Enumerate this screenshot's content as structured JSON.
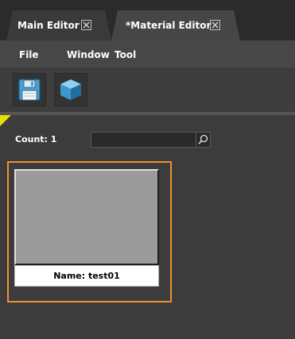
{
  "tabs": [
    {
      "label": "Main Editor",
      "active": false
    },
    {
      "label": "*Material Editor",
      "active": true
    }
  ],
  "menu": {
    "file": "File",
    "window": "Window",
    "tool": "Tool"
  },
  "toolbar": {
    "save_icon": "floppy-disk-icon",
    "cube_icon": "cube-icon"
  },
  "browser": {
    "count_label": "Count: 1",
    "search_value": "",
    "search_icon": "magnifier-icon"
  },
  "materials": [
    {
      "name_label": "Name: test01",
      "selected": true
    }
  ],
  "colors": {
    "selection_border": "#f0922b",
    "preview_fill": "#9b9b9b",
    "corner_marker": "#e8e000"
  }
}
